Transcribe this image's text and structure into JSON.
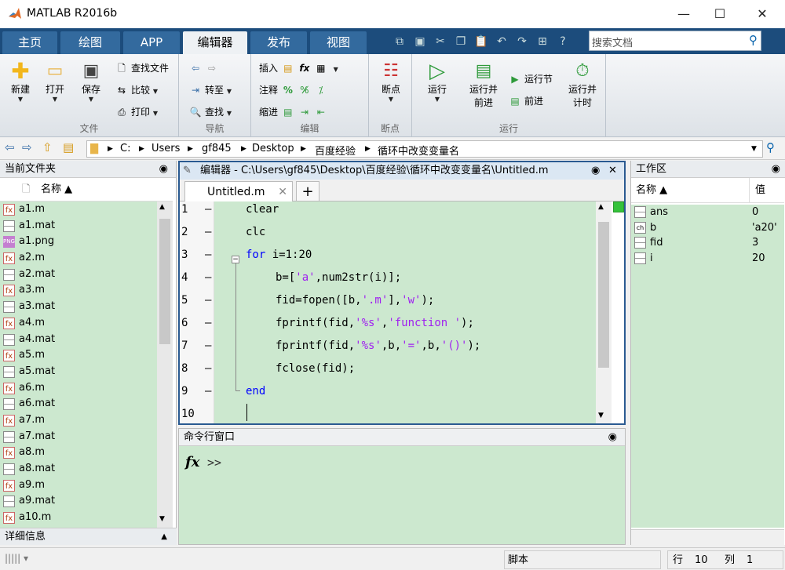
{
  "window": {
    "title": "MATLAB R2016b",
    "minimize": "—",
    "maximize": "☐",
    "close": "✕"
  },
  "tabs": [
    {
      "label": "主页"
    },
    {
      "label": "绘图"
    },
    {
      "label": "APP"
    },
    {
      "label": "编辑器"
    },
    {
      "label": "发布"
    },
    {
      "label": "视图"
    }
  ],
  "search": {
    "placeholder": "搜索文档"
  },
  "ribbon": {
    "file": {
      "label": "文件",
      "new": "新建",
      "open": "打开",
      "save": "保存",
      "find_files": "查找文件",
      "compare": "比较",
      "print": "打印"
    },
    "nav": {
      "label": "导航",
      "goto": "转至",
      "find": "查找"
    },
    "edit": {
      "label": "编辑",
      "insert": "插入",
      "comment": "注释",
      "indent": "缩进"
    },
    "breakpoints": {
      "label": "断点",
      "btn": "断点"
    },
    "run": {
      "label": "运行",
      "run": "运行",
      "run_advance_1": "运行并",
      "run_advance_2": "前进",
      "run_section": "运行节",
      "advance": "前进",
      "run_time_1": "运行并",
      "run_time_2": "计时"
    }
  },
  "address": {
    "drive": "C:",
    "parts": [
      "Users",
      "gf845",
      "Desktop",
      "百度经验",
      "循环中改变变量名"
    ]
  },
  "filepanel": {
    "title": "当前文件夹",
    "col_name": "名称 ▲",
    "files": [
      {
        "name": "a1.m",
        "type": "m"
      },
      {
        "name": "a1.mat",
        "type": "mat"
      },
      {
        "name": "a1.png",
        "type": "png"
      },
      {
        "name": "a2.m",
        "type": "m"
      },
      {
        "name": "a2.mat",
        "type": "mat"
      },
      {
        "name": "a3.m",
        "type": "m"
      },
      {
        "name": "a3.mat",
        "type": "mat"
      },
      {
        "name": "a4.m",
        "type": "m"
      },
      {
        "name": "a4.mat",
        "type": "mat"
      },
      {
        "name": "a5.m",
        "type": "m"
      },
      {
        "name": "a5.mat",
        "type": "mat"
      },
      {
        "name": "a6.m",
        "type": "m"
      },
      {
        "name": "a6.mat",
        "type": "mat"
      },
      {
        "name": "a7.m",
        "type": "m"
      },
      {
        "name": "a7.mat",
        "type": "mat"
      },
      {
        "name": "a8.m",
        "type": "m"
      },
      {
        "name": "a8.mat",
        "type": "mat"
      },
      {
        "name": "a9.m",
        "type": "m"
      },
      {
        "name": "a9.mat",
        "type": "mat"
      },
      {
        "name": "a10.m",
        "type": "m"
      }
    ],
    "details": "详细信息"
  },
  "editor": {
    "header": "编辑器 - C:\\Users\\gf845\\Desktop\\百度经验\\循环中改变变量名\\Untitled.m",
    "tab": "Untitled.m",
    "add": "+",
    "lines": [
      {
        "n": "1",
        "indent": 1,
        "html": "clear"
      },
      {
        "n": "2",
        "indent": 1,
        "html": "clc"
      },
      {
        "n": "3",
        "indent": 1,
        "html": "<span class=\"kw\">for</span> i=1:20"
      },
      {
        "n": "4",
        "indent": 2,
        "html": "b=[<span class=\"st\">'a'</span>,num2str(i)];"
      },
      {
        "n": "5",
        "indent": 2,
        "html": "fid=fopen([b,<span class=\"st\">'.m'</span>],<span class=\"st\">'w'</span>);"
      },
      {
        "n": "6",
        "indent": 2,
        "html": "fprintf(fid,<span class=\"st\">'%s'</span>,<span class=\"st\">'function '</span>);"
      },
      {
        "n": "7",
        "indent": 2,
        "html": "fprintf(fid,<span class=\"st\">'%s'</span>,b,<span class=\"st\">'='</span>,b,<span class=\"st\">'()'</span>);"
      },
      {
        "n": "8",
        "indent": 2,
        "html": "fclose(fid);"
      },
      {
        "n": "9",
        "indent": 1,
        "html": "<span class=\"kw\">end</span>"
      },
      {
        "n": "10",
        "indent": 1,
        "html": ""
      }
    ]
  },
  "cmd": {
    "title": "命令行窗口",
    "prompt": ">>"
  },
  "workspace": {
    "title": "工作区",
    "col_name": "名称 ▲",
    "col_value": "值",
    "vars": [
      {
        "name": "ans",
        "value": "0"
      },
      {
        "name": "b",
        "value": "'a20'"
      },
      {
        "name": "fid",
        "value": "3"
      },
      {
        "name": "i",
        "value": "20"
      }
    ]
  },
  "status": {
    "mode": "脚本",
    "row_label": "行",
    "row": "10",
    "col_label": "列",
    "col": "1"
  }
}
